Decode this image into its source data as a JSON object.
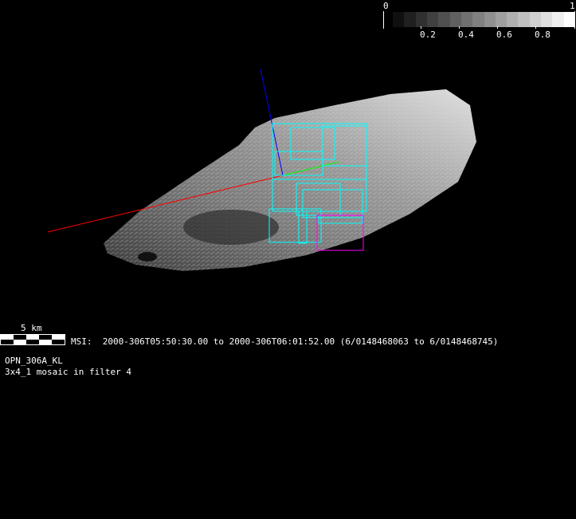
{
  "colorbar": {
    "min_label": "0",
    "max_label": "1",
    "tick_labels": [
      "0.2",
      "0.4",
      "0.6",
      "0.8"
    ],
    "steps": 16
  },
  "scale": {
    "label": "5 km"
  },
  "info": {
    "instrument_line": "MSI:  2000-306T05:50:30.00 to 2000-306T06:01:52.00 (6/0148468063 to 6/0148468745)",
    "sequence": "OPN_306A_KL",
    "mosaic": "3x4_1 mosaic in filter 4"
  },
  "colors": {
    "x_axis": "#ff0000",
    "y_axis": "#00ff00",
    "z_axis": "#0000ff",
    "footprint": "#00ffff",
    "footprint_alt": "#ff00ff"
  }
}
